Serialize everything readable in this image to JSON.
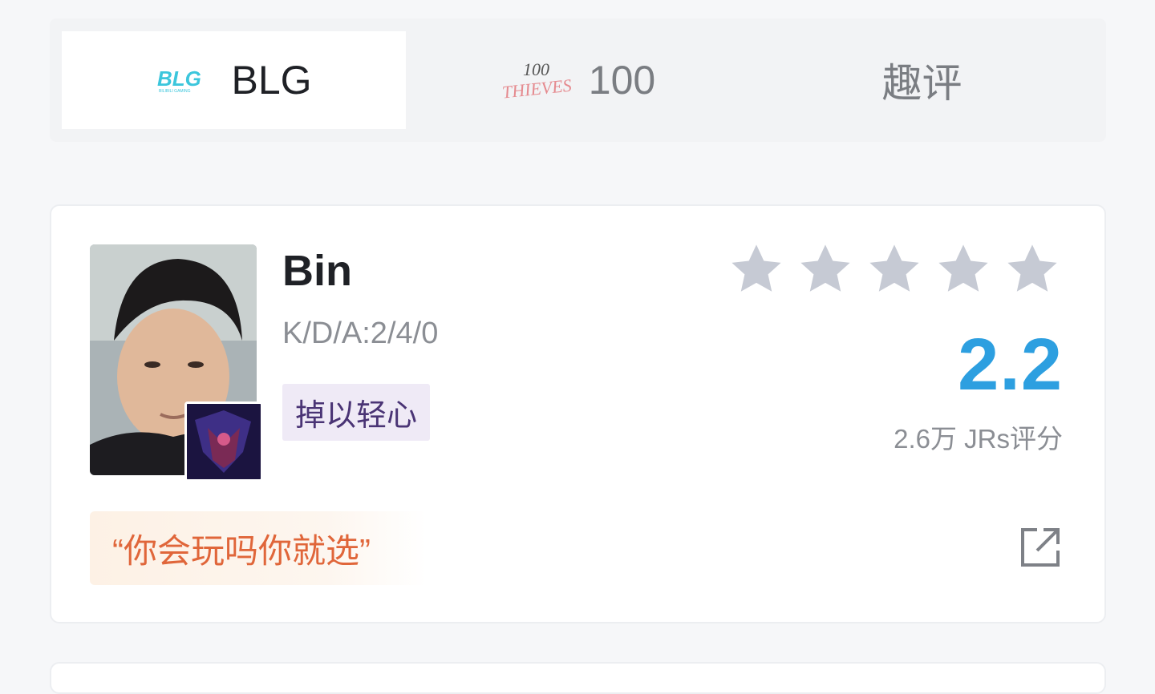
{
  "tabs": [
    {
      "label": "BLG",
      "logo_text": "BLG",
      "active": true
    },
    {
      "label": "100",
      "logo_text": "100 THIEVES",
      "active": false
    },
    {
      "label": "趣评",
      "active": false
    }
  ],
  "player": {
    "name": "Bin",
    "kda": "K/D/A:2/4/0",
    "tag": "掉以轻心",
    "rating": "2.2",
    "votes": "2.6万 JRs评分",
    "stars_filled": 0,
    "stars_total": 5,
    "quote": "“你会玩吗你就选”"
  },
  "colors": {
    "rating": "#2d9fe0",
    "quote": "#e0663a",
    "tag_text": "#4a3475",
    "star": "#c6cad4"
  },
  "icons": {
    "star": "star-icon",
    "share": "share-icon"
  }
}
